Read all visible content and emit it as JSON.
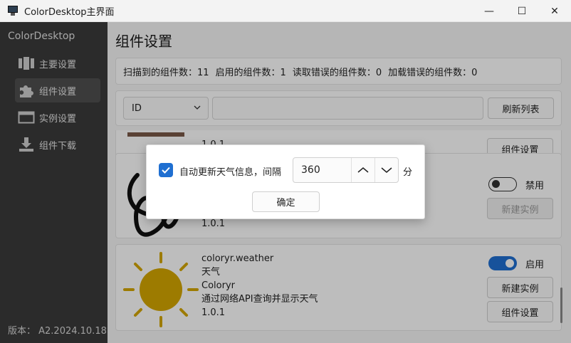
{
  "window": {
    "title": "ColorDesktop主界面",
    "controls": {
      "minimize": "—",
      "maximize": "☐",
      "close": "✕"
    }
  },
  "sidebar": {
    "brand": "ColorDesktop",
    "items": [
      {
        "label": "主要设置",
        "icon": "panels-icon",
        "active": false
      },
      {
        "label": "组件设置",
        "icon": "puzzle-icon",
        "active": true
      },
      {
        "label": "实例设置",
        "icon": "window-icon",
        "active": false
      },
      {
        "label": "组件下载",
        "icon": "download-icon",
        "active": false
      }
    ],
    "version": "版本：  A2.2024.10.18"
  },
  "main": {
    "title": "组件设置",
    "stats": {
      "scanned": "扫描到的组件数：11",
      "enabled": "启用的组件数：1",
      "read_errors": "读取错误的组件数：0",
      "load_errors": "加载错误的组件数：0"
    },
    "filter": {
      "selected": "ID",
      "search_value": "",
      "refresh_label": "刷新列表"
    },
    "cards": [
      {
        "partial": true,
        "version": "1.0.1",
        "button_label": "组件设置"
      },
      {
        "icon": "signature-icon",
        "version": "1.0.1",
        "toggle_label": "禁用",
        "toggle_on": false,
        "new_instance_label": "新建实例"
      },
      {
        "icon": "sun-icon",
        "id": "coloryr.weather",
        "name": "天气",
        "author": "Coloryr",
        "description": "通过网络API查询并显示天气",
        "version": "1.0.1",
        "toggle_label": "启用",
        "toggle_on": true,
        "new_instance_label": "新建实例",
        "settings_label": "组件设置"
      }
    ]
  },
  "dialog": {
    "checkbox_checked": true,
    "label": "自动更新天气信息，间隔",
    "interval_value": "360",
    "unit": "分",
    "confirm_label": "确定"
  },
  "colors": {
    "accent": "#1f6fd1",
    "sidebar_bg": "#3a3a3a",
    "sun": "#d4a600"
  }
}
